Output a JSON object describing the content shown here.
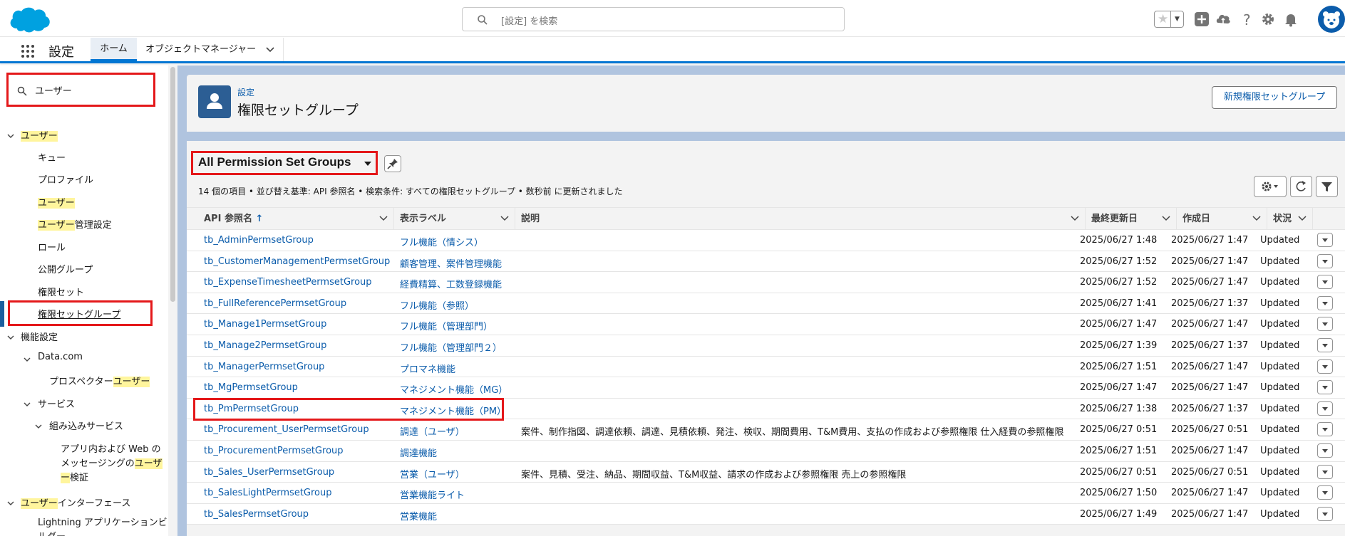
{
  "header": {
    "search_placeholder": "[設定] を検索",
    "icons": [
      "favorites-star-icon",
      "add-icon",
      "trailhead-icon",
      "help-icon",
      "setup-gear-icon",
      "notifications-bell-icon",
      "avatar"
    ]
  },
  "nav": {
    "app_name": "設定",
    "tabs": [
      {
        "label": "ホーム",
        "active": true
      },
      {
        "label": "オブジェクトマネージャー",
        "active": false
      }
    ]
  },
  "sidebar": {
    "search_value": "ユーザー",
    "items": [
      {
        "label_hl": "ユーザー",
        "label_rest": "",
        "level": 0,
        "expanded": true
      },
      {
        "label_hl": "",
        "label_rest": "キュー",
        "level": 1
      },
      {
        "label_hl": "",
        "label_rest": "プロファイル",
        "level": 1
      },
      {
        "label_hl": "ユーザー",
        "label_rest": "",
        "level": 1
      },
      {
        "label_hl": "ユーザー",
        "label_rest": "管理設定",
        "level": 1
      },
      {
        "label_hl": "",
        "label_rest": "ロール",
        "level": 1
      },
      {
        "label_hl": "",
        "label_rest": "公開グループ",
        "level": 1
      },
      {
        "label_hl": "",
        "label_rest": "権限セット",
        "level": 1
      },
      {
        "label_hl": "",
        "label_rest": "権限セットグループ",
        "level": 1,
        "selected": true
      },
      {
        "label_hl": "",
        "label_rest": "機能設定",
        "level": 0,
        "expanded": true
      },
      {
        "label_hl": "",
        "label_rest": "Data.com",
        "level": 1,
        "expanded": true
      },
      {
        "label_pre": "プロスペクター",
        "label_hl": "ユーザー",
        "level": 2
      },
      {
        "label_hl": "",
        "label_rest": "サービス",
        "level": 1,
        "expanded": true
      },
      {
        "label_hl": "",
        "label_rest": "組み込みサービス",
        "level": 2,
        "expanded": true
      },
      {
        "line1": "アプリ内および Web の",
        "line2_pre": "メッセージングの",
        "line2_hl": "ユーザ",
        "line3_hl": "ー",
        "line3_rest": "検証",
        "level": 3
      },
      {
        "label_hl": "ユーザー",
        "label_rest": "インターフェース",
        "level": 0,
        "expanded": true
      },
      {
        "line1": "Lightning アプリケーションビ",
        "line2": "ルダー",
        "level": 1
      }
    ]
  },
  "page": {
    "breadcrumb": "設定",
    "title": "権限セットグループ",
    "new_button": "新規権限セットグループ"
  },
  "list": {
    "view_name": "All Permission Set Groups",
    "meta": "14 個の項目 • 並び替え基準: API 参照名 • 検索条件: すべての権限セットグループ • 数秒前 に更新されました",
    "columns": [
      "API 参照名",
      "表示ラベル",
      "説明",
      "最終更新日",
      "作成日",
      "状況"
    ],
    "sort_indicator": "↑",
    "rows": [
      {
        "api": "tb_AdminPermsetGroup",
        "label": "フル機能（情シス）",
        "desc": "",
        "modified": "2025/06/27 1:48",
        "created": "2025/06/27 1:47",
        "status": "Updated"
      },
      {
        "api": "tb_CustomerManagementPermsetGroup",
        "label": "顧客管理、案件管理機能",
        "desc": "",
        "modified": "2025/06/27 1:52",
        "created": "2025/06/27 1:47",
        "status": "Updated"
      },
      {
        "api": "tb_ExpenseTimesheetPermsetGroup",
        "label": "経費精算、工数登録機能",
        "desc": "",
        "modified": "2025/06/27 1:52",
        "created": "2025/06/27 1:47",
        "status": "Updated"
      },
      {
        "api": "tb_FullReferencePermsetGroup",
        "label": "フル機能（参照）",
        "desc": "",
        "modified": "2025/06/27 1:41",
        "created": "2025/06/27 1:37",
        "status": "Updated"
      },
      {
        "api": "tb_Manage1PermsetGroup",
        "label": "フル機能（管理部門）",
        "desc": "",
        "modified": "2025/06/27 1:47",
        "created": "2025/06/27 1:47",
        "status": "Updated"
      },
      {
        "api": "tb_Manage2PermsetGroup",
        "label": "フル機能（管理部門２）",
        "desc": "",
        "modified": "2025/06/27 1:39",
        "created": "2025/06/27 1:37",
        "status": "Updated"
      },
      {
        "api": "tb_ManagerPermsetGroup",
        "label": "プロマネ機能",
        "desc": "",
        "modified": "2025/06/27 1:51",
        "created": "2025/06/27 1:47",
        "status": "Updated"
      },
      {
        "api": "tb_MgPermsetGroup",
        "label": "マネジメント機能（MG）",
        "desc": "",
        "modified": "2025/06/27 1:47",
        "created": "2025/06/27 1:47",
        "status": "Updated"
      },
      {
        "api": "tb_PmPermsetGroup",
        "label": "マネジメント機能（PM）",
        "desc": "",
        "modified": "2025/06/27 1:38",
        "created": "2025/06/27 1:37",
        "status": "Updated"
      },
      {
        "api": "tb_Procurement_UserPermsetGroup",
        "label": "調達（ユーザ）",
        "desc": "案件、制作指図、調達依頼、調達、見積依頼、発注、検収、期間費用、T&M費用、支払の作成および参照権限 仕入経費の参照権限",
        "modified": "2025/06/27 0:51",
        "created": "2025/06/27 0:51",
        "status": "Updated"
      },
      {
        "api": "tb_ProcurementPermsetGroup",
        "label": "調達機能",
        "desc": "",
        "modified": "2025/06/27 1:51",
        "created": "2025/06/27 1:47",
        "status": "Updated"
      },
      {
        "api": "tb_Sales_UserPermsetGroup",
        "label": "営業（ユーザ）",
        "desc": "案件、見積、受注、納品、期間収益、T&M収益、請求の作成および参照権限 売上の参照権限",
        "modified": "2025/06/27 0:51",
        "created": "2025/06/27 0:51",
        "status": "Updated"
      },
      {
        "api": "tb_SalesLightPermsetGroup",
        "label": "営業機能ライト",
        "desc": "",
        "modified": "2025/06/27 1:50",
        "created": "2025/06/27 1:47",
        "status": "Updated"
      },
      {
        "api": "tb_SalesPermsetGroup",
        "label": "営業機能",
        "desc": "",
        "modified": "2025/06/27 1:49",
        "created": "2025/06/27 1:47",
        "status": "Updated"
      }
    ]
  },
  "colors": {
    "brand": "#0176d3",
    "link": "#0b5cab",
    "highlight": "#fff59d",
    "annotation_red": "#e4181a"
  }
}
